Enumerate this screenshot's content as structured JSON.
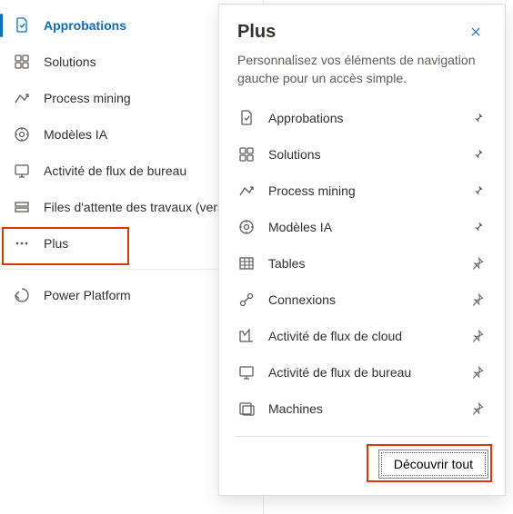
{
  "sidebar": {
    "items": [
      {
        "label": "Approbations",
        "icon": "approvals-icon",
        "active": true
      },
      {
        "label": "Solutions",
        "icon": "solutions-icon"
      },
      {
        "label": "Process mining",
        "icon": "process-mining-icon"
      },
      {
        "label": "Modèles IA",
        "icon": "ai-models-icon"
      },
      {
        "label": "Activité de flux de bureau",
        "icon": "desktop-flow-activity-icon"
      },
      {
        "label": "Files d'attente des travaux (version préliminaire)",
        "icon": "work-queues-icon"
      },
      {
        "label": "Plus",
        "icon": "more-icon"
      }
    ],
    "footer": [
      {
        "label": "Power Platform",
        "icon": "power-platform-icon"
      }
    ]
  },
  "flyout": {
    "title": "Plus",
    "description": "Personnalisez vos éléments de navigation gauche pour un accès simple.",
    "items": [
      {
        "label": "Approbations",
        "icon": "approvals-icon",
        "pinned": true
      },
      {
        "label": "Solutions",
        "icon": "solutions-icon",
        "pinned": true
      },
      {
        "label": "Process mining",
        "icon": "process-mining-icon",
        "pinned": true
      },
      {
        "label": "Modèles IA",
        "icon": "ai-models-icon",
        "pinned": true
      },
      {
        "label": "Tables",
        "icon": "tables-icon",
        "pinned": false
      },
      {
        "label": "Connexions",
        "icon": "connections-icon",
        "pinned": false
      },
      {
        "label": "Activité de flux de cloud",
        "icon": "cloud-flow-activity-icon",
        "pinned": false
      },
      {
        "label": "Activité de flux de bureau",
        "icon": "desktop-flow-activity-icon",
        "pinned": false
      },
      {
        "label": "Machines",
        "icon": "machines-icon",
        "pinned": false
      }
    ],
    "discover_label": "Découvrir tout"
  }
}
